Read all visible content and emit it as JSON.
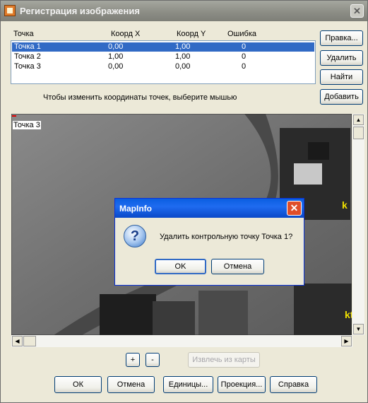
{
  "window": {
    "title": "Регистрация изображения",
    "close_glyph": "✕"
  },
  "table": {
    "headers": [
      "Точка",
      "Коорд X",
      "Коорд Y",
      "Ошибка"
    ],
    "rows": [
      {
        "name": "Точка 1",
        "x": "0,00",
        "y": "1,00",
        "err": "0"
      },
      {
        "name": "Точка 2",
        "x": "1,00",
        "y": "1,00",
        "err": "0"
      },
      {
        "name": "Точка 3",
        "x": "0,00",
        "y": "0,00",
        "err": "0"
      }
    ]
  },
  "side_buttons": {
    "edit": "Правка...",
    "delete": "Удалить",
    "find": "Найти",
    "add": "Добавить"
  },
  "hint": "Чтобы изменить координаты точек, выберите мышью",
  "map": {
    "point_label": "Точка 3",
    "marker_glyph": "k",
    "marker_glyph2": "kt"
  },
  "zoom": {
    "in": "+",
    "out": "-"
  },
  "extract": "Извлечь из карты",
  "bottom_buttons": {
    "ok": "ОК",
    "cancel": "Отмена",
    "units": "Единицы...",
    "projection": "Проекция...",
    "help": "Справка"
  },
  "dialog": {
    "title": "MapInfo",
    "message": "Удалить контрольную точку Точка 1?",
    "ok": "OK",
    "cancel": "Отмена",
    "icon": "question-icon"
  },
  "colors": {
    "selection": "#316ac5",
    "dialog_title": "#0a5ee0",
    "marker": "#f0e000"
  }
}
